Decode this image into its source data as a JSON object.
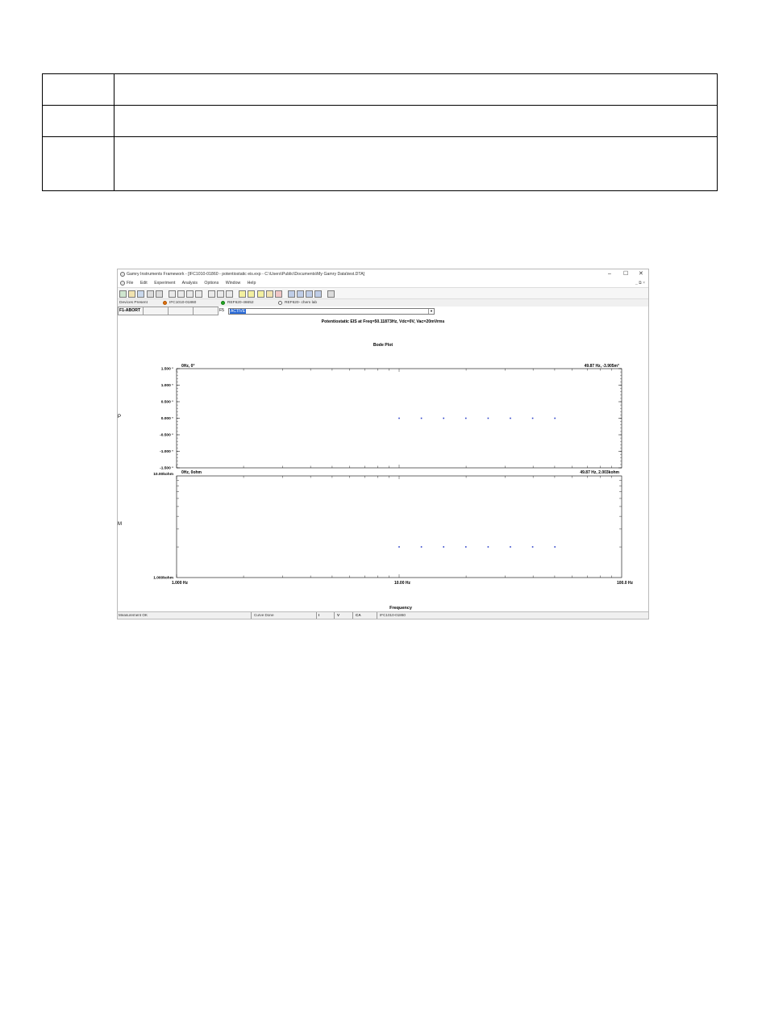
{
  "window": {
    "title": "Gamry Instruments Framework - [IFC1010-01860 - potentiostatic eis.exp - C:\\Users\\Public\\Documents\\My Gamry Data\\test.DTA]",
    "controls": {
      "minimize": "–",
      "maximize": "☐",
      "close": "✕"
    },
    "mdi_controls": "_ ⧉ ×"
  },
  "menu": [
    "File",
    "Edit",
    "Experiment",
    "Analysis",
    "Options",
    "Window",
    "Help"
  ],
  "devices": {
    "label": "Devices Present",
    "items": [
      {
        "name": "IFC1010-01860",
        "color": "#e07010"
      },
      {
        "name": "REF620-46652",
        "color": "#22a822"
      },
      {
        "name": "REF620- chem lab",
        "color": "#ffffff"
      }
    ]
  },
  "fkeys": {
    "f1": "F1-ABORT",
    "f5": "F5",
    "active": "ACTIVE"
  },
  "plot": {
    "main_title": "Potentiostatic EIS at Freq=50.11873Hz, Vdc=0V, Vac=20mVrms",
    "subtitle": "Bode Plot",
    "xlabel": "Frequency",
    "phase_axis_label": "P",
    "mag_axis_label": "M",
    "phase_left_corner": "0Hz, 0°",
    "phase_right_corner": "49.87 Hz, -3.905m°",
    "mag_left_corner": "0Hz, 0ohm",
    "mag_right_corner": "49.87 Hz, 2.003kohm"
  },
  "chart_data": {
    "type": "scatter",
    "x_scale": "log",
    "xlim": [
      1,
      100
    ],
    "x_ticks": [
      "1.000 Hz",
      "10.00 Hz",
      "100.0 Hz"
    ],
    "phase": {
      "ylim": [
        -1.5,
        1.5
      ],
      "y_ticks": [
        "1.500 °",
        "1.000 °",
        "0.500 °",
        "0.000 °",
        "-0.500 °",
        "-1.000 °",
        "-1.500 °"
      ],
      "points": [
        [
          10.0,
          0.0
        ],
        [
          12.59,
          0.0
        ],
        [
          15.85,
          0.0
        ],
        [
          19.95,
          0.0
        ],
        [
          25.12,
          0.0
        ],
        [
          31.62,
          0.0
        ],
        [
          39.81,
          0.0
        ],
        [
          50.12,
          0.0
        ]
      ]
    },
    "magnitude": {
      "y_scale": "log",
      "ylim": [
        1000,
        10000
      ],
      "y_ticks": [
        "10.00kohm",
        "1.000kohm"
      ],
      "points": [
        [
          10.0,
          2003
        ],
        [
          12.59,
          2003
        ],
        [
          15.85,
          2003
        ],
        [
          19.95,
          2003
        ],
        [
          25.12,
          2003
        ],
        [
          31.62,
          2003
        ],
        [
          39.81,
          2003
        ],
        [
          50.12,
          2003
        ]
      ]
    },
    "marker_color": "#2a3fc8"
  },
  "status": {
    "message": "Measurement OK",
    "curve": "Curve Done",
    "i": "I",
    "v": "V",
    "ca": "CA",
    "device": "IFC1010-01860"
  }
}
